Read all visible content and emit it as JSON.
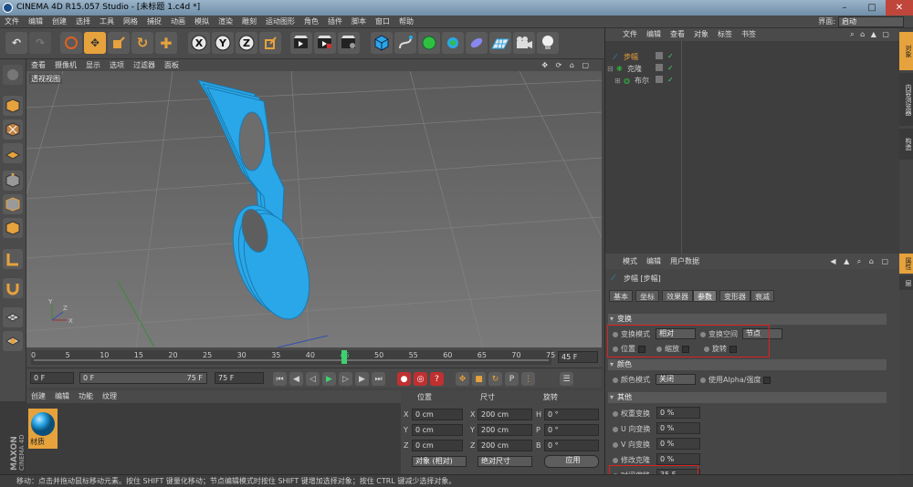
{
  "title": "CINEMA 4D R15.057 Studio - [未标题 1.c4d *]",
  "menubar": [
    "文件",
    "编辑",
    "创建",
    "选择",
    "工具",
    "网格",
    "捕捉",
    "动画",
    "模拟",
    "渲染",
    "雕刻",
    "运动图形",
    "角色",
    "插件",
    "脚本",
    "窗口",
    "帮助"
  ],
  "layout": {
    "label": "界面:",
    "value": "启动"
  },
  "viewport": {
    "menu": [
      "查看",
      "摄像机",
      "显示",
      "选项",
      "过滤器",
      "面板"
    ],
    "label": "透视视图"
  },
  "timeline": {
    "ticks": [
      "0",
      "5",
      "10",
      "15",
      "20",
      "25",
      "30",
      "35",
      "40",
      "45",
      "50",
      "55",
      "60",
      "65",
      "70",
      "75"
    ],
    "current": "45",
    "end_field": "45 F"
  },
  "controls": {
    "start": "0 F",
    "range_start": "0 F",
    "range_end": "75 F",
    "end": "75 F"
  },
  "materials": {
    "menu": [
      "创建",
      "编辑",
      "功能",
      "纹理"
    ],
    "item": "材质"
  },
  "coords": {
    "headers": [
      "位置",
      "尺寸",
      "旋转"
    ],
    "axes": [
      "X",
      "Y",
      "Z"
    ],
    "rot_axes": [
      "H",
      "P",
      "B"
    ],
    "pos": [
      "0 cm",
      "0 cm",
      "0 cm"
    ],
    "size": [
      "200 cm",
      "200 cm",
      "200 cm"
    ],
    "rot": [
      "0 °",
      "0 °",
      "0 °"
    ],
    "mode": "对象 (相对)",
    "size_mode": "绝对尺寸",
    "apply": "应用"
  },
  "objects": {
    "menu": [
      "文件",
      "编辑",
      "查看",
      "对象",
      "标签",
      "书签"
    ],
    "items": [
      {
        "name": "步幅"
      },
      {
        "name": "克隆"
      },
      {
        "name": "布尔"
      }
    ]
  },
  "attributes": {
    "menu": [
      "模式",
      "编辑",
      "用户数据"
    ],
    "object_title": "步幅 [步幅]",
    "tabs": [
      "基本",
      "坐标",
      "效果器",
      "参数",
      "变形器",
      "衰减"
    ],
    "active_tab": "参数",
    "sec_transform": "变换",
    "transform_mode_label": "变换模式",
    "transform_mode": "相对",
    "transform_space_label": "变换空间",
    "transform_space": "节点",
    "pos_label": "位置",
    "scale_label": "缩放",
    "rotate_label": "旋转",
    "sec_color": "颜色",
    "color_mode_label": "颜色模式",
    "color_mode": "关闭",
    "use_alpha": "使用Alpha/强度",
    "sec_other": "其他",
    "weight_label": "权重变换",
    "weight": "0 %",
    "u_label": "U 向变换",
    "u": "0 %",
    "v_label": "V 向变换",
    "v": "0 %",
    "modclone_label": "修改克隆",
    "modclone": "0 %",
    "timeoffset_label": "时间偏移",
    "timeoffset": "35 F"
  },
  "sidetabs": [
    "对象",
    "内容浏览器",
    "构造",
    "属性",
    "层"
  ],
  "statusbar": "移动：点击并拖动鼠标移动元素。按住 SHIFT 键量化移动；节点编辑模式时按住 SHIFT 键增加选择对象；按住 CTRL 键减少选择对象。",
  "colors": {
    "accent": "#2aa7e8",
    "highlight": "#e6a23c",
    "red": "#e02020"
  }
}
